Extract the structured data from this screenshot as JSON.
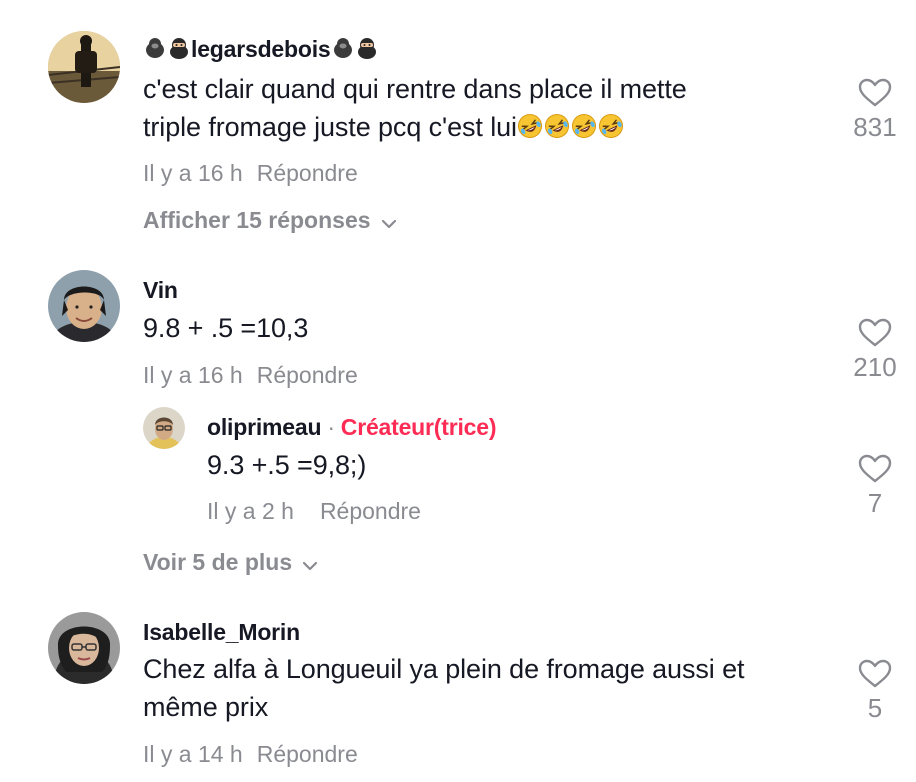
{
  "comments": [
    {
      "username": "legarsdebois",
      "text_line1": "c'est clair quand qui rentre dans place il mette",
      "text_line2": "triple fromage juste pcq c'est lui",
      "emoji": "rolling-on-floor-laughing-icon",
      "emoji_count": 4,
      "time": "Il y a 16 h",
      "reply_label": "Répondre",
      "likes": "831",
      "expand_label": "Afficher 15 réponses"
    },
    {
      "username": "Vin",
      "text_line1": "9.8 + .5 =10,3",
      "time": "Il y a 16 h",
      "reply_label": "Répondre",
      "likes": "210",
      "reply": {
        "username": "oliprimeau",
        "separator": "·",
        "creator_label": "Créateur(trice)",
        "text": "9.3 +.5 =9,8;)",
        "time": "Il y a 2 h",
        "reply_label": "Répondre",
        "likes": "7"
      },
      "expand_label": "Voir 5 de plus"
    },
    {
      "username": "Isabelle_Morin",
      "text_line1": "Chez alfa à Longueuil ya plein de fromage aussi et",
      "text_line2": "même prix",
      "time": "Il y a 14 h",
      "reply_label": "Répondre",
      "likes": "5"
    }
  ],
  "colors": {
    "text": "#161823",
    "secondary": "#8a8b91",
    "creator": "#fe2c55"
  }
}
